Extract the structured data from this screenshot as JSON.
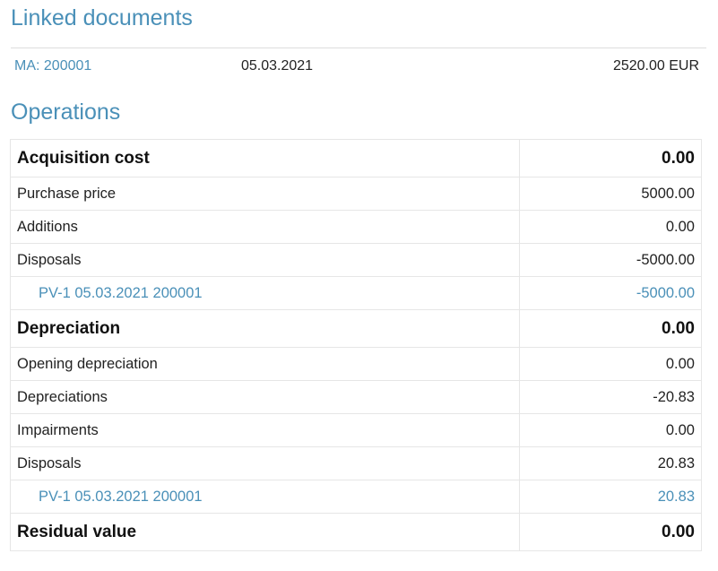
{
  "linked_documents": {
    "title": "Linked documents",
    "items": [
      {
        "reference": "MA: 200001",
        "date": "05.03.2021",
        "amount": "2520.00 EUR"
      }
    ]
  },
  "operations": {
    "title": "Operations",
    "rows": [
      {
        "label": "Acquisition cost",
        "value": "0.00"
      },
      {
        "label": "Purchase price",
        "value": "5000.00"
      },
      {
        "label": "Additions",
        "value": "0.00"
      },
      {
        "label": "Disposals",
        "value": "-5000.00"
      },
      {
        "label": "PV-1 05.03.2021 200001",
        "value": "-5000.00"
      },
      {
        "label": "Depreciation",
        "value": "0.00"
      },
      {
        "label": "Opening depreciation",
        "value": "0.00"
      },
      {
        "label": "Depreciations",
        "value": "-20.83"
      },
      {
        "label": "Impairments",
        "value": "0.00"
      },
      {
        "label": "Disposals",
        "value": "20.83"
      },
      {
        "label": "PV-1 05.03.2021 200001",
        "value": "20.83"
      },
      {
        "label": "Residual value",
        "value": "0.00"
      }
    ]
  },
  "colors": {
    "accent": "#4a90b8",
    "text": "#222222",
    "border": "#e6e6e6"
  }
}
